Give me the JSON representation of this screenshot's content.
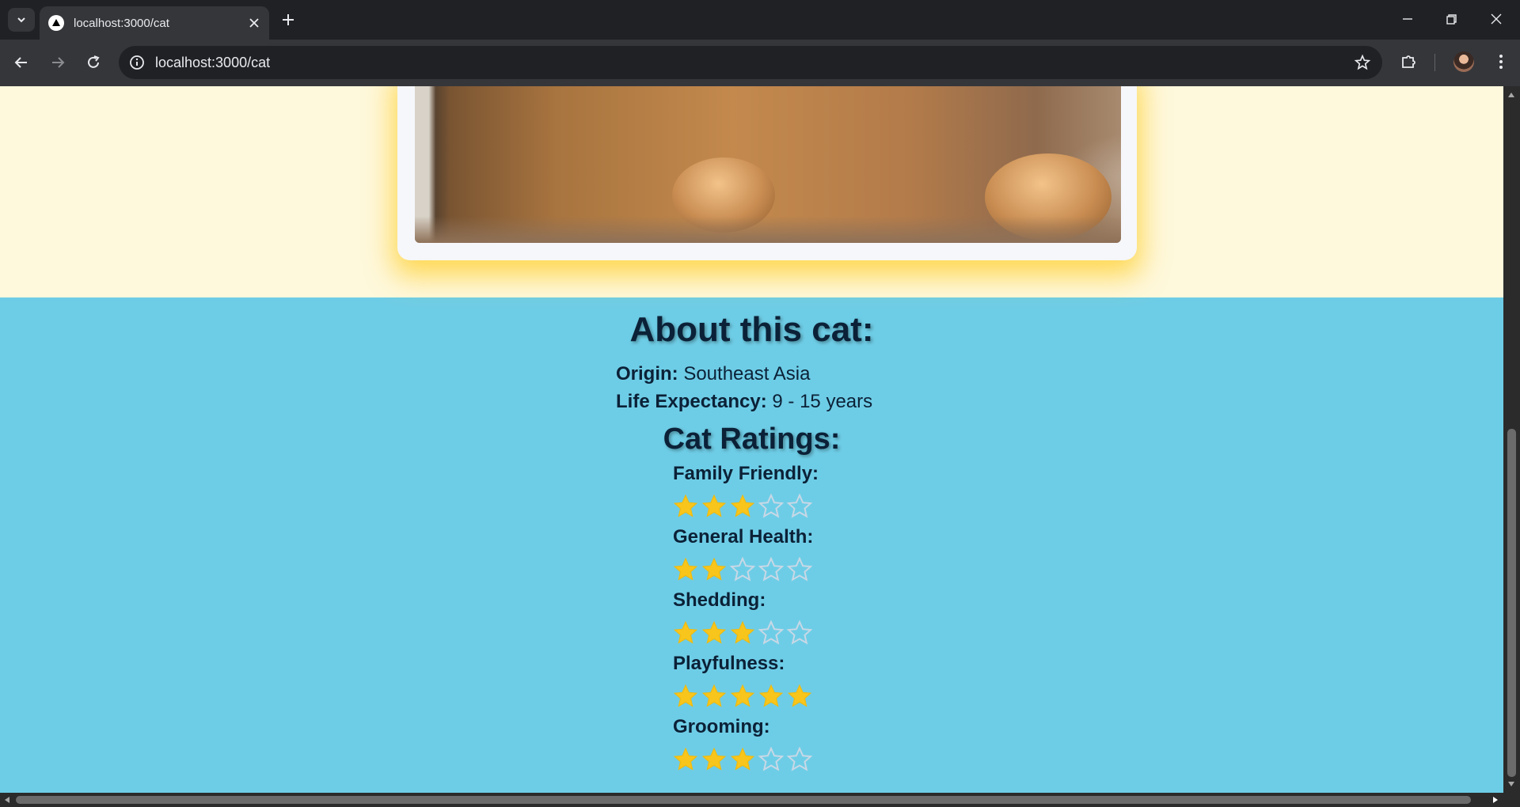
{
  "browser": {
    "tab_title": "localhost:3000/cat",
    "url": "localhost:3000/cat",
    "icons": [
      "tab-search-icon",
      "vercel-favicon-icon",
      "close-icon",
      "plus-icon",
      "minimize-icon",
      "restore-icon",
      "close-window-icon",
      "back-arrow-icon",
      "forward-arrow-icon",
      "reload-icon",
      "info-icon",
      "star-bookmark-icon",
      "extensions-puzzle-icon",
      "avatar",
      "kebab-menu-icon"
    ]
  },
  "page": {
    "colors": {
      "hero_background": "#fef8dc",
      "section_background": "#6ecde6",
      "card_glow": "#ffcd28",
      "heading_text": "#0b2137",
      "star_filled": "#f7c51b",
      "star_empty": "#c8d8e6"
    },
    "about": {
      "title": "About this cat:",
      "origin_label": "Origin:",
      "origin_value": "Southeast Asia",
      "life_label": "Life Expectancy:",
      "life_value": "9 - 15 years"
    },
    "ratings": {
      "title": "Cat Ratings:",
      "max": 5,
      "items": [
        {
          "label": "Family Friendly:",
          "value": 3
        },
        {
          "label": "General Health:",
          "value": 2
        },
        {
          "label": "Shedding:",
          "value": 3
        },
        {
          "label": "Playfulness:",
          "value": 5
        },
        {
          "label": "Grooming:",
          "value": 3
        }
      ]
    }
  }
}
